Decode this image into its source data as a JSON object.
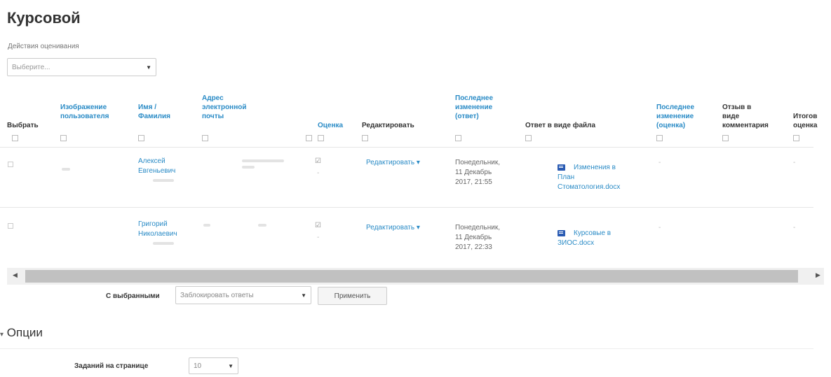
{
  "page_title": "Курсовой",
  "grading_actions": {
    "label": "Действия оценивания",
    "placeholder": "Выберите..."
  },
  "columns": {
    "select": "Выбрать",
    "picture": [
      "Изображение",
      "пользователя"
    ],
    "name": [
      "Имя /",
      "Фамилия"
    ],
    "email": [
      "Адрес",
      "электронной",
      "почты"
    ],
    "grade": "Оценка",
    "edit": "Редактировать",
    "last_modified_submission": [
      "Последнее",
      "изменение",
      "(ответ)"
    ],
    "file_submissions": "Ответ в виде файла",
    "last_modified_grade": [
      "Последнее",
      "изменение",
      "(оценка)"
    ],
    "feedback_comments": [
      "Отзыв в",
      "виде",
      "комментария"
    ],
    "final_grade": [
      "Итогов",
      "оценка"
    ]
  },
  "rows": [
    {
      "name": [
        "Алексей",
        "Евгеньевич"
      ],
      "grade_dash": "-",
      "edit": "Редактировать ▾",
      "last_modified": [
        "Понедельник,",
        "11 Декабрь",
        "2017, 21:55"
      ],
      "file": [
        "Изменения в",
        "План",
        "Стоматология.docx"
      ],
      "last_modified_grade": "-",
      "final_grade": "-"
    },
    {
      "name": [
        "Григорий",
        "Николаевич"
      ],
      "grade_dash": "-",
      "edit": "Редактировать ▾",
      "last_modified": [
        "Понедельник,",
        "11 Декабрь",
        "2017, 22:33"
      ],
      "file": [
        "Курсовые в",
        "ЗИОС.docx"
      ],
      "last_modified_grade": "-",
      "final_grade": "-"
    }
  ],
  "bulk": {
    "label": "С выбранными",
    "option": "Заблокировать ответы",
    "apply": "Применить"
  },
  "options": {
    "heading": "Опции",
    "per_page_label": "Заданий на странице",
    "per_page_value": "10"
  },
  "icons": {
    "collapse": "collapse-icon",
    "checkbox": "checkbox-icon",
    "grade": "grade-icon",
    "file": "word-document-icon",
    "dropdown": "chevron-down-icon",
    "scroll-left": "scroll-left-icon",
    "scroll-right": "scroll-right-icon",
    "options-toggle": "caret-down-icon"
  }
}
